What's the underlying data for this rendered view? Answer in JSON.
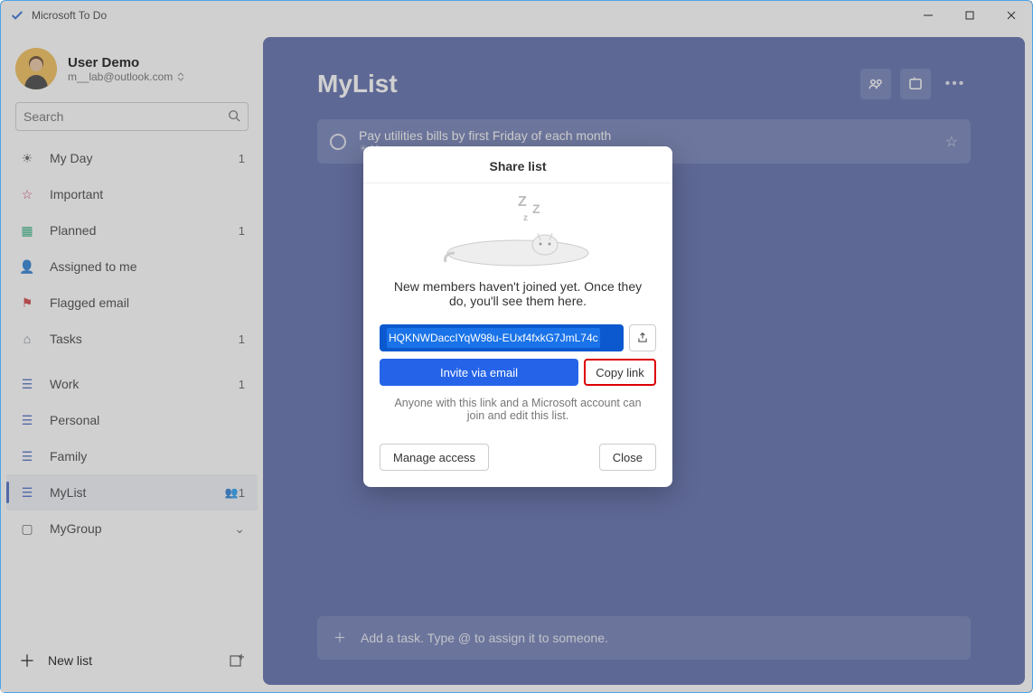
{
  "titlebar": {
    "title": "Microsoft To Do"
  },
  "user": {
    "name": "User Demo",
    "email": "m__lab@outlook.com"
  },
  "search": {
    "placeholder": "Search"
  },
  "nav": {
    "myday": {
      "label": "My Day",
      "badge": "1"
    },
    "important": {
      "label": "Important"
    },
    "planned": {
      "label": "Planned",
      "badge": "1"
    },
    "assigned": {
      "label": "Assigned to me"
    },
    "flagged": {
      "label": "Flagged email"
    },
    "tasks": {
      "label": "Tasks",
      "badge": "1"
    },
    "work": {
      "label": "Work",
      "badge": "1"
    },
    "personal": {
      "label": "Personal"
    },
    "family": {
      "label": "Family"
    },
    "mylist": {
      "label": "MyList",
      "badge": "1"
    },
    "mygroup": {
      "label": "MyGroup"
    }
  },
  "newlist": {
    "label": "New list"
  },
  "main": {
    "title": "MyList",
    "task1": "Pay utilities bills by first Friday of each month",
    "task1_sub": "M…",
    "add_task": "Add a task. Type @ to assign it to someone."
  },
  "dialog": {
    "title": "Share list",
    "message": "New members haven't joined yet. Once they do, you'll see them here.",
    "link": "HQKNWDaccIYqW98u-EUxf4fxkG7JmL74c",
    "invite": "Invite via email",
    "copy": "Copy link",
    "note": "Anyone with this link and a Microsoft account can join and edit this list.",
    "manage": "Manage access",
    "close": "Close"
  }
}
